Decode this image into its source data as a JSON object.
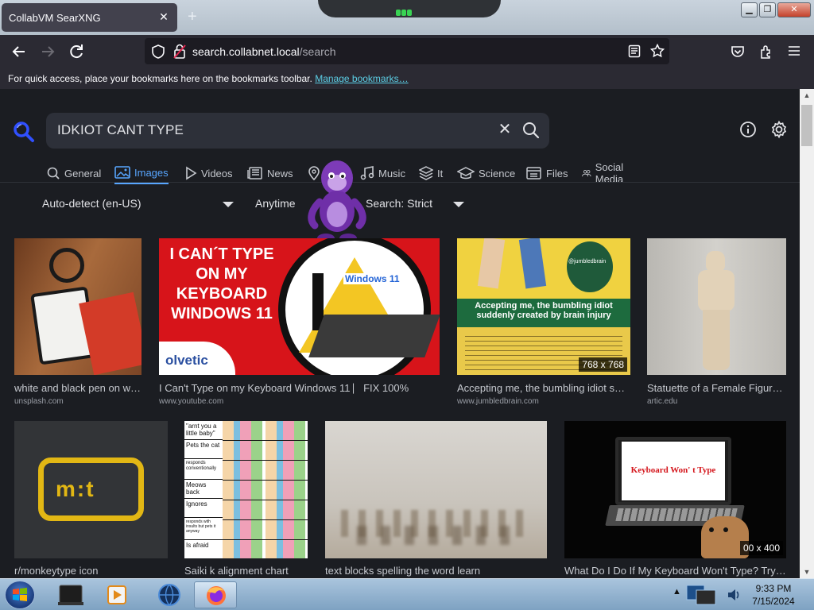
{
  "window": {
    "tab_title": "CollabVM SearXNG",
    "tab_close": "✕",
    "new_tab": "+"
  },
  "navbar": {
    "url_host": "search.collabnet.local",
    "url_path": "/search"
  },
  "bookmarks_bar": {
    "text": "For quick access, place your bookmarks here on the bookmarks toolbar.",
    "link": "Manage bookmarks…"
  },
  "search": {
    "query": "IDKIOT CANT TYPE",
    "clear": "✕"
  },
  "categories": [
    {
      "label": "General",
      "icon": "search-icon"
    },
    {
      "label": "Images",
      "icon": "image-icon",
      "active": true
    },
    {
      "label": "Videos",
      "icon": "play-icon"
    },
    {
      "label": "News",
      "icon": "newspaper-icon"
    },
    {
      "label": "",
      "icon": "map-pin-icon"
    },
    {
      "label": "Music",
      "icon": "music-icon"
    },
    {
      "label": "It",
      "icon": "layers-icon"
    },
    {
      "label": "Science",
      "icon": "graduation-cap-icon"
    },
    {
      "label": "Files",
      "icon": "files-icon"
    },
    {
      "label": "Social Media",
      "icon": "people-icon"
    }
  ],
  "filters": {
    "language": "Auto-detect (en-US)",
    "time": "Anytime",
    "safesearch": "Search: Strict"
  },
  "results": [
    {
      "title": "white and black pen on w…",
      "source": "unsplash.com",
      "dims": ""
    },
    {
      "title": "I Can't Type on my Keyboard Windows 11 ⎸FIX 100%",
      "source": "www.youtube.com",
      "dims": "",
      "overlay_lines": [
        "I CAN´T TYPE",
        "ON MY",
        "KEYBOARD",
        "WINDOWS 11"
      ],
      "brand": "olvetic",
      "win_label": "Windows 11"
    },
    {
      "title": "Accepting me, the bumbling idiot su…",
      "source": "www.jumbledbrain.com",
      "dims": "768 x 768",
      "overlay": "Accepting me, the bumbling idiot suddenly created by brain injury",
      "handle": "@jumbledbrain"
    },
    {
      "title": "Statuette of a Female Figur…",
      "source": "artic.edu",
      "dims": ""
    },
    {
      "title": "r/monkeytype icon",
      "source": "",
      "dims": ""
    },
    {
      "title": "Saiki k alignment chart",
      "source": "",
      "dims": "",
      "chart_rows": [
        "\"arnt you a little baby\"",
        "Pets the cat",
        "responds conventionally",
        "Meows back",
        "Ignores",
        "responds with insults but pets it anyway",
        "Is afraid"
      ]
    },
    {
      "title": "text blocks spelling the word learn",
      "source": "",
      "dims": ""
    },
    {
      "title": "What Do I Do If My Keyboard Won't Type? Try…",
      "source": "",
      "dims": "00 x 400",
      "screen_text": "Keyboard Won' t Type"
    }
  ],
  "taskbar": {
    "time": "9:33 PM",
    "date": "7/15/2024"
  },
  "colors": {
    "page_bg": "#1b1d22",
    "accent": "#58a6ff",
    "search_box": "#2d3039",
    "firefox_chrome": "#2b2a33"
  }
}
